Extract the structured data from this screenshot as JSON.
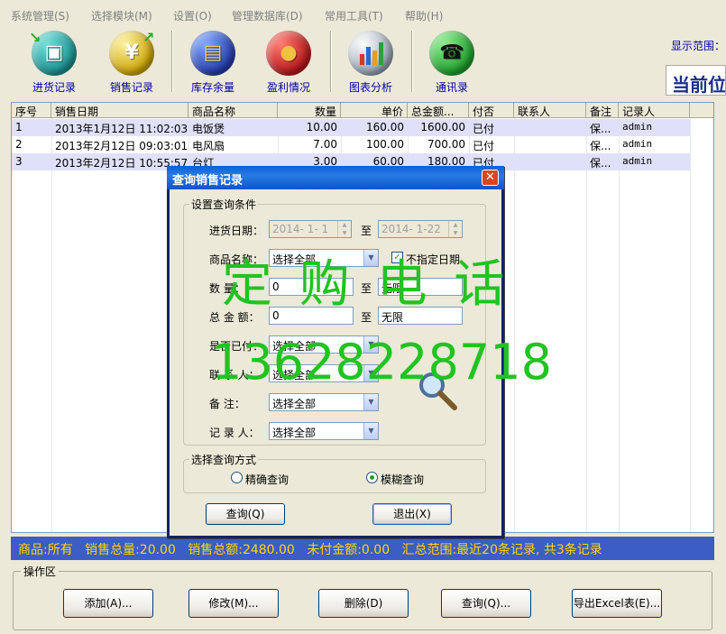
{
  "menu": [
    "系统管理(S)",
    "选择模块(M)",
    "设置(O)",
    "管理数据库(D)",
    "常用工具(T)",
    "帮助(H)"
  ],
  "toolbar": {
    "buttons": [
      {
        "label": "进货记录",
        "icon": "purchase-record-icon",
        "color": "#1a8f8f"
      },
      {
        "label": "销售记录",
        "icon": "sales-record-icon",
        "color": "#c8a100"
      },
      {
        "label": "库存余量",
        "icon": "inventory-icon",
        "color": "#233aa8"
      },
      {
        "label": "盈利情况",
        "icon": "profit-icon",
        "color": "#b4161a"
      },
      {
        "label": "图表分析",
        "icon": "chart-analysis-icon",
        "color": "#8a9aa8"
      },
      {
        "label": "通讯录",
        "icon": "phone-book-icon",
        "color": "#1c9a2a"
      }
    ],
    "range_label": "显示范围：",
    "current_label": "当前位"
  },
  "grid": {
    "columns": [
      "序号",
      "销售日期",
      "商品名称",
      "数量",
      "单价",
      "总金额...",
      "付否",
      "联系人",
      "备注",
      "记录人"
    ],
    "rows": [
      [
        "1",
        "2013年1月12日  11:02:03",
        "电饭煲",
        "10.00",
        "160.00",
        "1600.00",
        "已付",
        "",
        "保...",
        "admin"
      ],
      [
        "2",
        "2013年2月12日  09:03:01",
        "电风扇",
        "7.00",
        "100.00",
        "700.00",
        "已付",
        "",
        "保...",
        "admin"
      ],
      [
        "3",
        "2013年2月12日  10:55:57",
        "台灯",
        "3.00",
        "60.00",
        "180.00",
        "已付",
        "",
        "保...",
        "admin"
      ]
    ]
  },
  "status": {
    "product": "商品:所有",
    "total_qty": "销售总量:20.00",
    "total_amount": "销售总额:2480.00",
    "unpaid": "未付金额:0.00",
    "summary": "汇总范围:最近20条记录, 共3条记录"
  },
  "ops": {
    "title": "操作区",
    "add": "添加(A)...",
    "edit": "修改(M)...",
    "delete": "删除(D)",
    "query": "查询(Q)...",
    "export": "导出Excel表(E)..."
  },
  "dialog": {
    "title": "查询销售记录",
    "conditions_title": "设置查询条件",
    "purchase_date_label": "进货日期：",
    "date_from": "2014- 1- 1",
    "to_1": "至",
    "date_to": "2014- 1-22",
    "product_label": "商品名称：",
    "product_value": "选择全部",
    "no_date_label": "不指定日期",
    "qty_label": "数    量：",
    "qty_from": "0",
    "to_2": "至",
    "qty_to": "无限",
    "amount_label": "总 金 额：",
    "amount_from": "0",
    "to_3": "至",
    "amount_to": "无限",
    "paid_label": "是否已付：",
    "paid_value": "选择全部",
    "contact_label": "联 系 人：",
    "contact_value": "选择全部",
    "remark_label": "备    注：",
    "remark_value": "选择全部",
    "recorder_label": "记 录 人：",
    "recorder_value": "选择全部",
    "mode_title": "选择查询方式",
    "exact_label": "精确查询",
    "fuzzy_label": "模糊查询",
    "query_button": "查询(Q)",
    "exit_button": "退出(X)"
  },
  "watermark": {
    "line1": "定 购 电 话",
    "line2": "13628228718"
  }
}
